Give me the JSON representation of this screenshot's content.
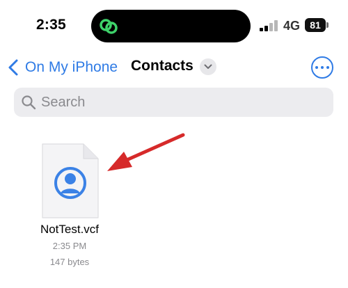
{
  "status_bar": {
    "time": "2:35",
    "network": "4G",
    "battery": "81"
  },
  "nav": {
    "back_label": "On My iPhone",
    "title": "Contacts"
  },
  "search": {
    "placeholder": "Search"
  },
  "files": [
    {
      "name": "NotTest.vcf",
      "time": "2:35 PM",
      "size": "147 bytes"
    }
  ],
  "colors": {
    "accent": "#2f7be5",
    "annotation_arrow": "#d62a2a",
    "island_icon": "#3ed26a",
    "contact_icon": "#3b82e6"
  },
  "icons": {
    "back": "chevron-left-icon",
    "title_menu": "chevron-down-icon",
    "more": "ellipsis-circle-icon",
    "search": "magnifying-glass-icon",
    "file": "contact-card-document-icon",
    "island": "link-icon"
  }
}
